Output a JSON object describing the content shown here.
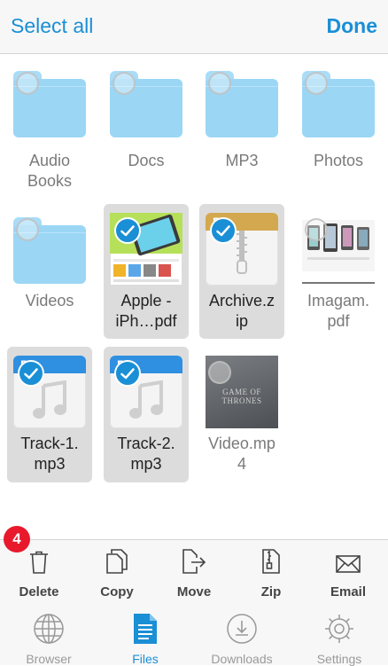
{
  "header": {
    "select_all": "Select all",
    "done": "Done"
  },
  "files": [
    {
      "name": "Audio\nBooks",
      "line1": "Audio",
      "line2": "Books",
      "selected": false
    },
    {
      "line1": "Docs",
      "selected": false
    },
    {
      "line1": "MP3",
      "selected": false
    },
    {
      "line1": "Photos",
      "selected": false
    },
    {
      "line1": "Videos",
      "selected": false
    },
    {
      "line1": "Apple -",
      "line2": "iPh…pdf",
      "selected": true
    },
    {
      "line1": "Archive.z",
      "line2": "ip",
      "selected": true,
      "thumb_band": "P"
    },
    {
      "line1": "Imagam.",
      "line2": "pdf",
      "selected": false
    },
    {
      "line1": "Track-1.",
      "line2": "mp3",
      "selected": true,
      "thumb_band": "P3"
    },
    {
      "line1": "Track-2.",
      "line2": "mp3",
      "selected": true,
      "thumb_band": "P3"
    },
    {
      "line1": "Video.mp",
      "line2": "4",
      "selected": false,
      "thumb_text": "GAME OF THRONES"
    }
  ],
  "selection_count": "4",
  "actions": [
    {
      "label": "Delete",
      "icon": "trash-icon"
    },
    {
      "label": "Copy",
      "icon": "copy-icon"
    },
    {
      "label": "Move",
      "icon": "move-icon"
    },
    {
      "label": "Zip",
      "icon": "zip-icon"
    },
    {
      "label": "Email",
      "icon": "envelope-icon"
    }
  ],
  "tabs": [
    {
      "label": "Browser",
      "icon": "globe-icon",
      "active": false
    },
    {
      "label": "Files",
      "icon": "document-icon",
      "active": true
    },
    {
      "label": "Downloads",
      "icon": "download-icon",
      "active": false
    },
    {
      "label": "Settings",
      "icon": "gear-icon",
      "active": false
    }
  ],
  "colors": {
    "accent": "#1a8fd6",
    "folder": "#9bd6f5",
    "badge": "#e8192c",
    "mp3_band": "#2f8fe0",
    "zip_band": "#d3a84e"
  }
}
